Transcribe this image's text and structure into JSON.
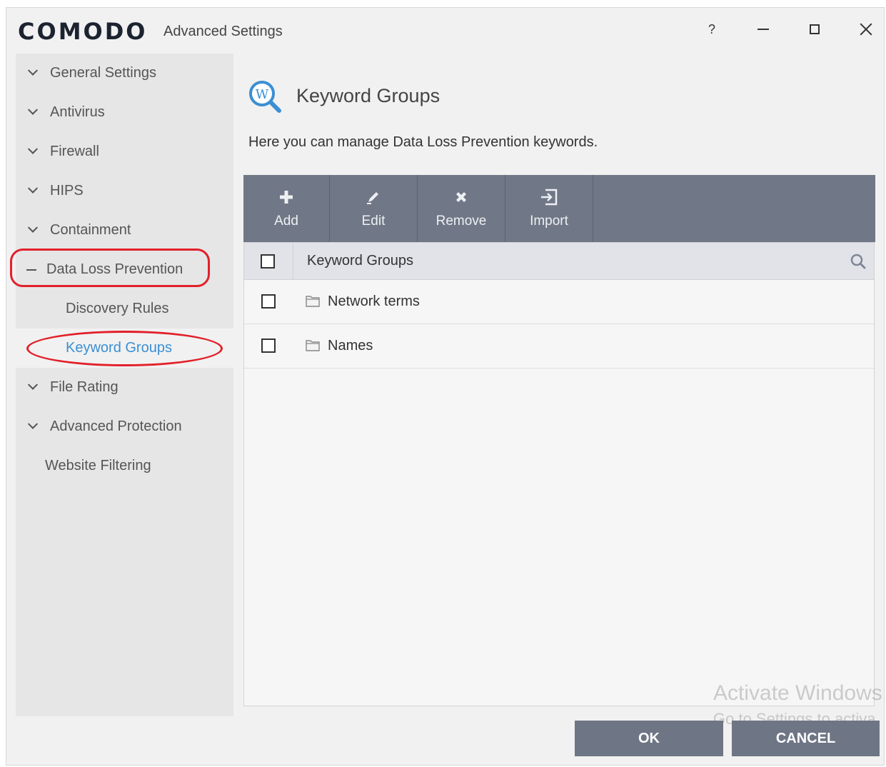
{
  "titlebar": {
    "brand": "COMODO",
    "title": "Advanced Settings",
    "help": "?"
  },
  "sidebar": {
    "items": [
      {
        "label": "General Settings",
        "icon": "chevron-down-icon"
      },
      {
        "label": "Antivirus",
        "icon": "chevron-down-icon"
      },
      {
        "label": "Firewall",
        "icon": "chevron-down-icon"
      },
      {
        "label": "HIPS",
        "icon": "chevron-down-icon"
      },
      {
        "label": "Containment",
        "icon": "chevron-down-icon"
      },
      {
        "label": "Data Loss Prevention",
        "icon": "collapse-dash-icon",
        "expanded": true
      },
      {
        "label": "Discovery Rules"
      },
      {
        "label": "Keyword Groups",
        "active": true
      },
      {
        "label": "File Rating",
        "icon": "chevron-down-icon"
      },
      {
        "label": "Advanced Protection",
        "icon": "chevron-down-icon"
      },
      {
        "label": "Website Filtering"
      }
    ]
  },
  "main": {
    "title": "Keyword Groups",
    "description": "Here you can manage Data Loss Prevention keywords.",
    "toolbar": [
      {
        "label": "Add",
        "icon": "plus-icon"
      },
      {
        "label": "Edit",
        "icon": "pencil-icon"
      },
      {
        "label": "Remove",
        "icon": "x-icon"
      },
      {
        "label": "Import",
        "icon": "import-icon"
      }
    ],
    "table": {
      "header": "Keyword Groups",
      "rows": [
        "Network terms",
        "Names"
      ]
    }
  },
  "footer": {
    "ok": "OK",
    "cancel": "CANCEL",
    "watermark_line1": "Activate Windows",
    "watermark_line2": "Go to Settings to activa"
  },
  "colors": {
    "toolbar": "#707786",
    "button": "#6e7585",
    "active_link": "#3b8fd3",
    "highlight_ring": "#e2202a"
  }
}
